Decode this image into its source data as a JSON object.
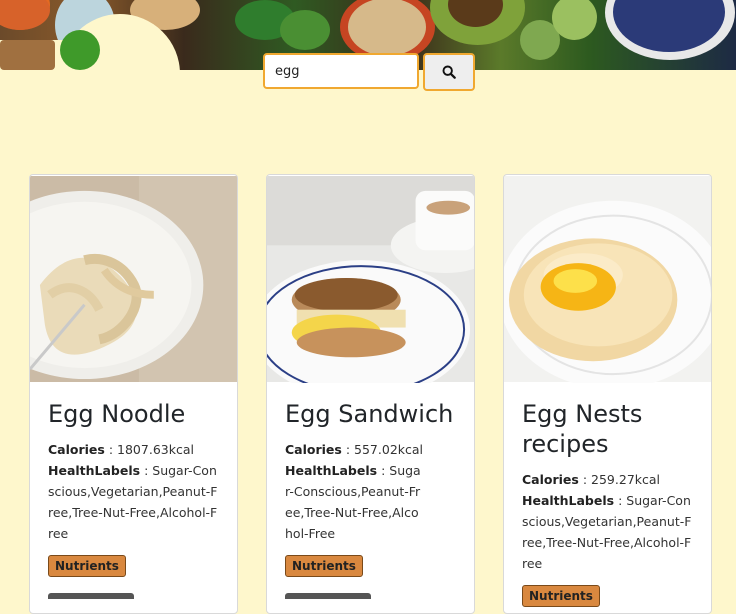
{
  "search": {
    "value": "egg"
  },
  "labels": {
    "calories": "Calories",
    "health": "HealthLabels",
    "separator": " : "
  },
  "recipes": [
    {
      "title": "Egg Noodle",
      "calories": "1807.63kcal",
      "health_labels": "Sugar-Conscious,Vegetarian,Peanut-Free,Tree-Nut-Free,Alcohol-Free",
      "button": "Nutrients"
    },
    {
      "title": "Egg Sandwich",
      "calories": "557.02kcal",
      "health_labels": "Sugar-Conscious,Peanut-Free,Tree-Nut-Free,Alcohol-Free",
      "button": "Nutrients"
    },
    {
      "title": "Egg Nests recipes",
      "calories": "259.27kcal",
      "health_labels": "Sugar-Conscious,Vegetarian,Peanut-Free,Tree-Nut-Free,Alcohol-Free",
      "button": "Nutrients"
    }
  ],
  "colors": {
    "page_bg": "#fef7cc",
    "accent": "#f0a830",
    "button": "#d9883f"
  },
  "icons": {
    "search_button": "search-icon"
  }
}
